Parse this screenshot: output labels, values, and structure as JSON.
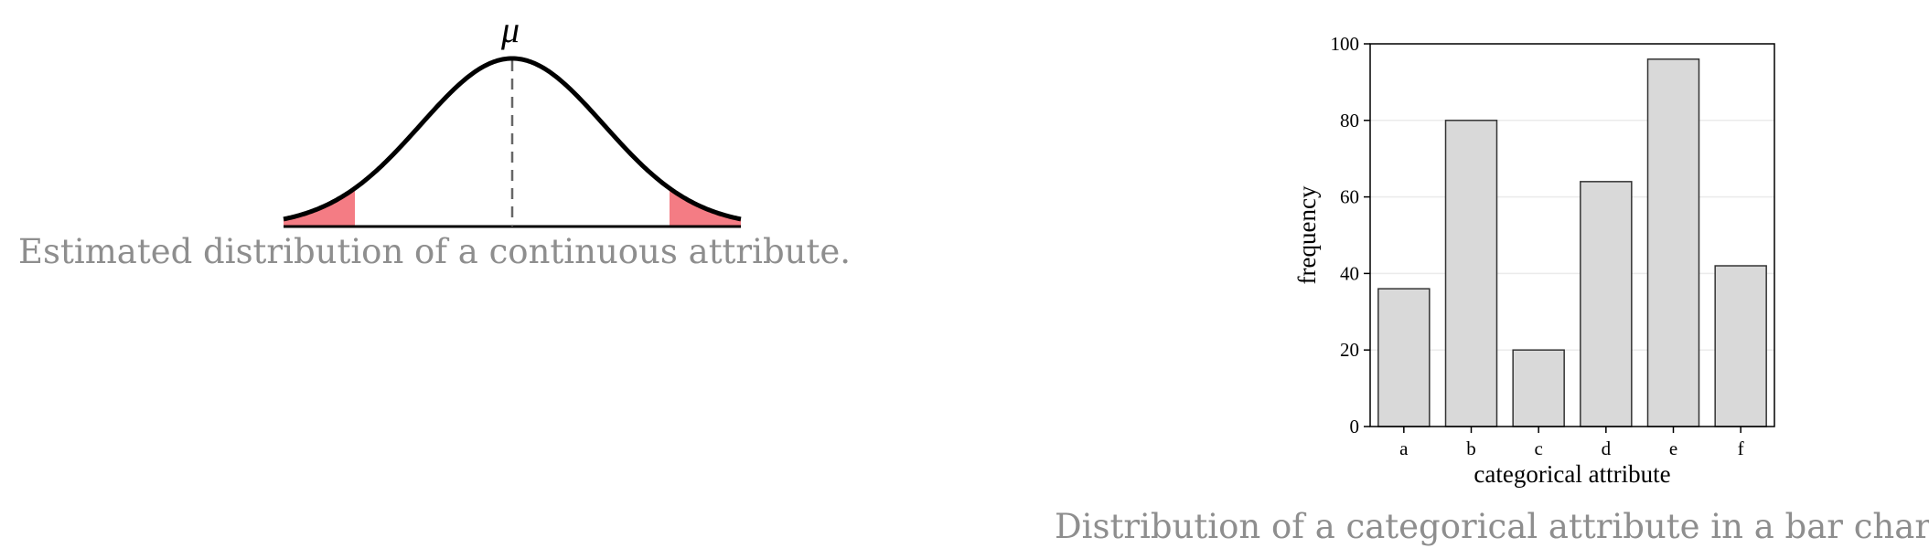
{
  "left_figure": {
    "mean_symbol": "μ",
    "caption": "Estimated distribution of a continuous attribute.",
    "colors": {
      "curve": "#000000",
      "tail_fill": "#f47c84",
      "mean_line": "#666666"
    }
  },
  "right_figure": {
    "caption": "Distribution of a categorical attribute in a bar chart.",
    "colors": {
      "bar_fill": "#d9d9d9",
      "bar_stroke": "#333333",
      "grid": "#ebebeb"
    }
  },
  "chart_data": [
    {
      "type": "line",
      "description_type": "normal-density",
      "title": "",
      "xlabel": "",
      "ylabel": "",
      "annotations": [
        "μ"
      ],
      "shaded_tails": [
        "left",
        "right"
      ],
      "mean_marker": "dashed-vertical"
    },
    {
      "type": "bar",
      "categories": [
        "a",
        "b",
        "c",
        "d",
        "e",
        "f"
      ],
      "values": [
        36,
        80,
        20,
        64,
        96,
        42
      ],
      "xlabel": "categorical attribute",
      "ylabel": "frequency",
      "ylim": [
        0,
        100
      ],
      "yticks": [
        0,
        20,
        40,
        60,
        80,
        100
      ],
      "grid": true,
      "title": ""
    }
  ]
}
